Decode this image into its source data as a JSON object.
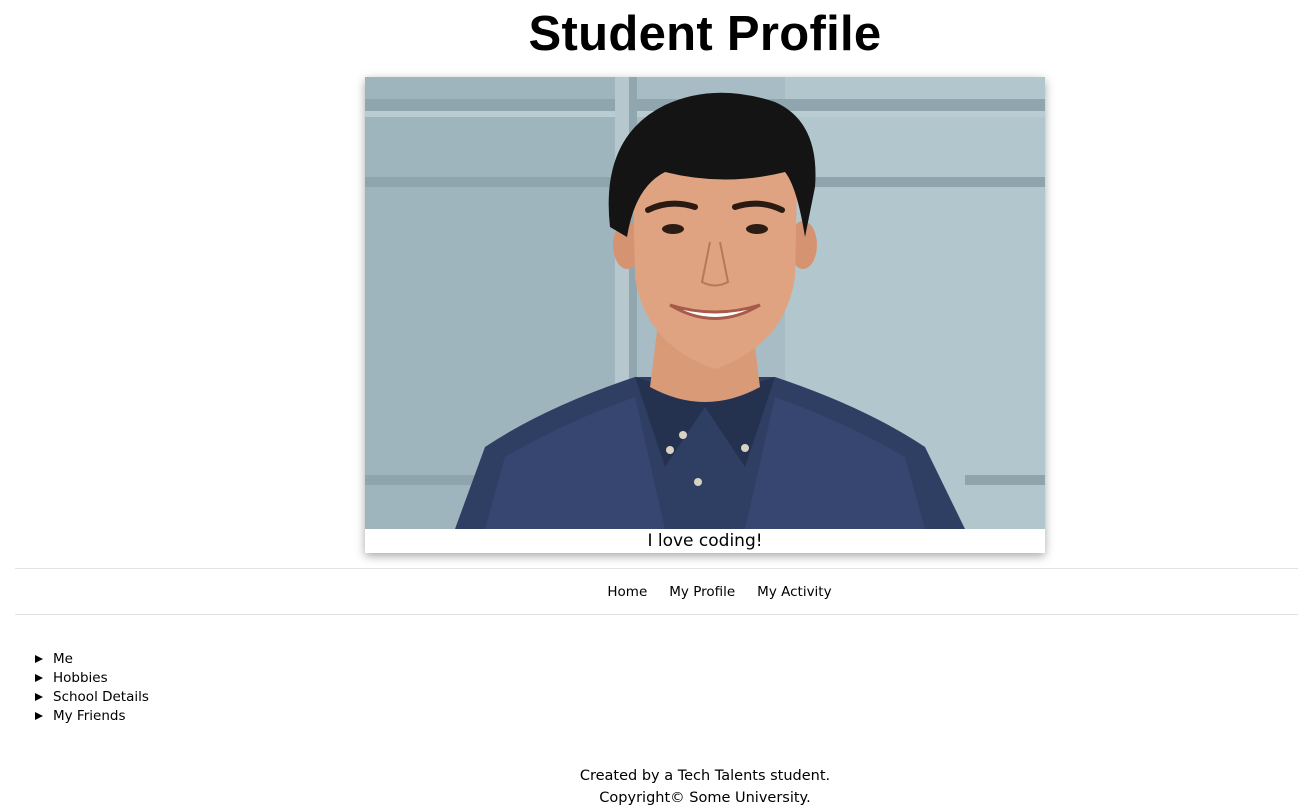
{
  "header": {
    "title": "Student Profile"
  },
  "profile": {
    "photo_alt": "portrait-photo",
    "caption": "I love coding!"
  },
  "nav": {
    "items": [
      {
        "label": "Home"
      },
      {
        "label": "My Profile"
      },
      {
        "label": "My Activity"
      }
    ]
  },
  "sections": {
    "items": [
      {
        "label": "Me"
      },
      {
        "label": "Hobbies"
      },
      {
        "label": "School Details"
      },
      {
        "label": "My Friends"
      }
    ]
  },
  "footer": {
    "line1": "Created by a Tech Talents student.",
    "line2": "Copyright© Some University."
  },
  "colors": {
    "background": "#ffffff",
    "text": "#000000",
    "divider": "#e3e3e3"
  }
}
